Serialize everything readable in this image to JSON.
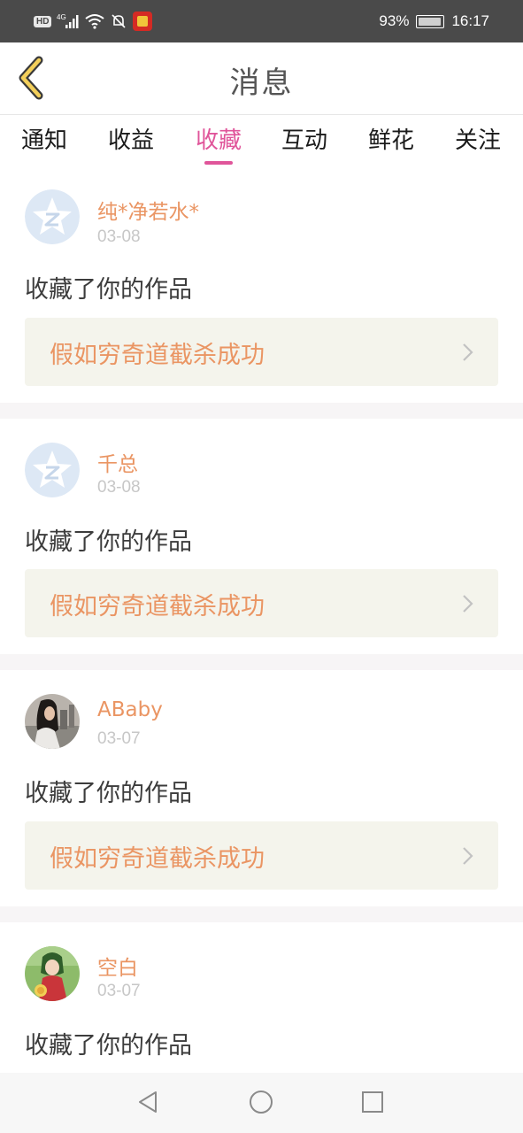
{
  "status_bar": {
    "network": "HD",
    "signal_label": "4G",
    "battery_percent": "93%",
    "battery_level": 0.93,
    "time": "16:17"
  },
  "nav": {
    "title": "消息",
    "back_icon": "chevron-left-icon"
  },
  "tabs": [
    {
      "label": "通知",
      "active": false
    },
    {
      "label": "收益",
      "active": false
    },
    {
      "label": "收藏",
      "active": true
    },
    {
      "label": "互动",
      "active": false
    },
    {
      "label": "鲜花",
      "active": false
    },
    {
      "label": "关注",
      "active": false
    }
  ],
  "messages": [
    {
      "username": "纯*净若水*",
      "time": "03-08",
      "action": "收藏了你的作品",
      "work_title": "假如穷奇道截杀成功",
      "avatar": "default-avatar"
    },
    {
      "username": "千总",
      "time": "03-08",
      "action": "收藏了你的作品",
      "work_title": "假如穷奇道截杀成功",
      "avatar": "default-avatar"
    },
    {
      "username": "ABaby",
      "time": "03-07",
      "action": "收藏了你的作品",
      "work_title": "假如穷奇道截杀成功",
      "avatar": "photo-avatar"
    },
    {
      "username": "空白",
      "time": "03-07",
      "action": "收藏了你的作品",
      "work_title": "",
      "avatar": "anime-avatar"
    }
  ],
  "colors": {
    "accent": "#e0559a",
    "username": "#ea9563",
    "work_box_bg": "#f4f4ec",
    "status_bar_bg": "#4a4a4a"
  },
  "system_nav": [
    "back-triangle-icon",
    "home-circle-icon",
    "recents-square-icon"
  ]
}
